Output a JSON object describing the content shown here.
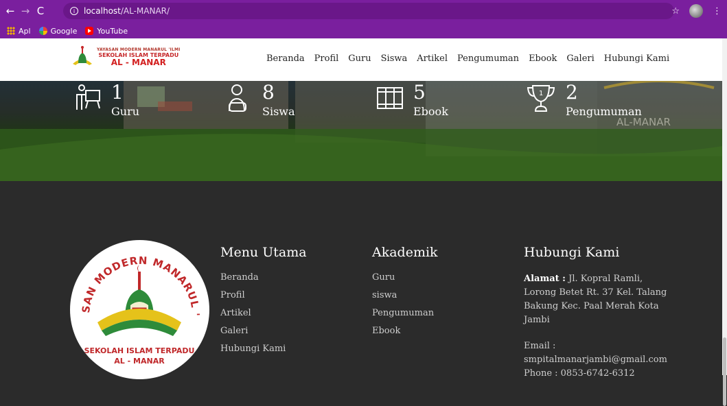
{
  "browser": {
    "url_host": "localhost",
    "url_path": "/AL-MANAR/",
    "bookmarks": [
      "Apl",
      "Google",
      "YouTube"
    ]
  },
  "site": {
    "logo": {
      "line1": "YAYASAN MODERN MANARUL 'ILMI",
      "line2": "SEKOLAH ISLAM TERPADU",
      "line3": "AL - MANAR"
    },
    "nav": [
      "Beranda",
      "Profil",
      "Guru",
      "Siswa",
      "Artikel",
      "Pengumuman",
      "Ebook",
      "Galeri",
      "Hubungi Kami"
    ]
  },
  "counters": [
    {
      "value": "1",
      "label": "Guru",
      "icon": "teacher-icon"
    },
    {
      "value": "8",
      "label": "Siswa",
      "icon": "student-icon"
    },
    {
      "value": "5",
      "label": "Ebook",
      "icon": "book-icon"
    },
    {
      "value": "2",
      "label": "Pengumuman",
      "icon": "trophy-icon"
    }
  ],
  "footer": {
    "badge": {
      "top": "YAYASAN MODERN MANARUL 'ILMI",
      "bottom1": "SEKOLAH ISLAM TERPADU",
      "bottom2": "AL - MANAR"
    },
    "menu_utama": {
      "title": "Menu Utama",
      "links": [
        "Beranda",
        "Profil",
        "Artikel",
        "Galeri",
        "Hubungi Kami"
      ]
    },
    "akademik": {
      "title": "Akademik",
      "links": [
        "Guru",
        "siswa",
        "Pengumuman",
        "Ebook"
      ]
    },
    "hubungi": {
      "title": "Hubungi Kami",
      "alamat_label": "Alamat :",
      "alamat": "Jl. Kopral Ramli, Lorong Betet Rt. 37 Kel. Talang Bakung Kec. Paal Merah Kota Jambi",
      "email_label": "Email :",
      "email": "smpitalmanarjambi@gmail.com",
      "phone": "Phone : 0853-6742-6312"
    }
  },
  "colors": {
    "chrome": "#7a1f9e",
    "footer_bg": "#2b2b2b",
    "logo_red": "#d32020"
  }
}
